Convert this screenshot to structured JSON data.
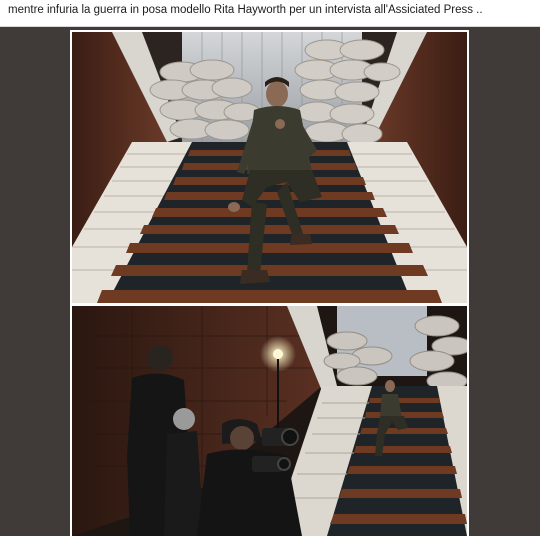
{
  "post": {
    "caption": "mentre infuria la guerra in posa modello Rita Hayworth per un intervista all'Assiciated Press .."
  },
  "photos": [
    {
      "subject": "man-seated-on-staircase",
      "icon": "photo-image"
    },
    {
      "subject": "photographers-shooting-staircase",
      "icon": "photo-image"
    }
  ],
  "colors": {
    "frame_background": "#403b38",
    "card_background": "#ffffff",
    "carpet_red": "#6e3a22",
    "carpet_dark": "#1f2428",
    "marble": "#e6e2da",
    "sandbag": "#cfcbc4",
    "wall": "#5a3022"
  }
}
